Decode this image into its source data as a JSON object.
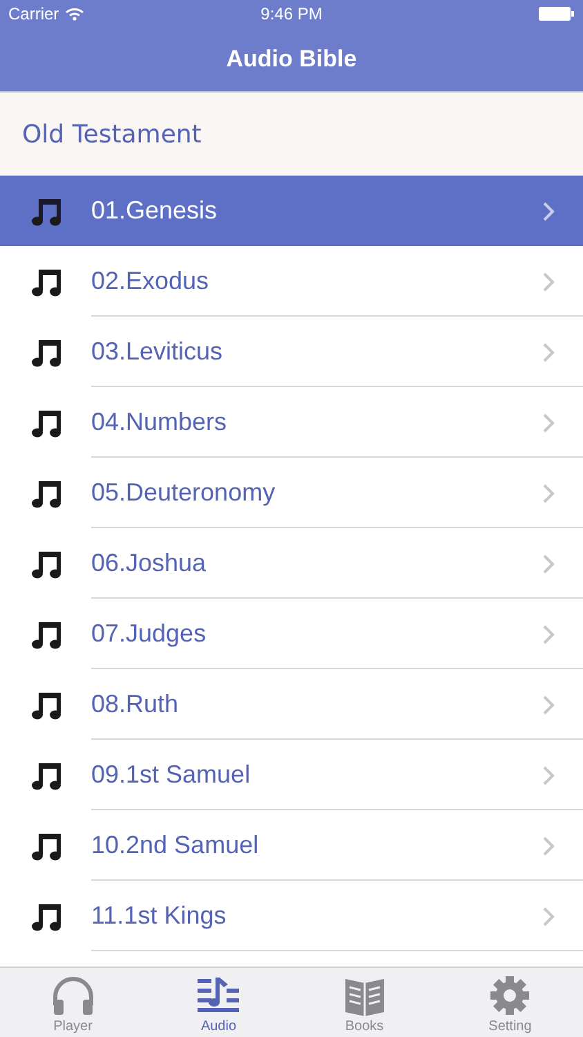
{
  "status_bar": {
    "carrier": "Carrier",
    "time": "9:46 PM"
  },
  "nav_bar": {
    "title": "Audio Bible"
  },
  "section": {
    "title": "Old Testament"
  },
  "rows": [
    {
      "label": "01.Genesis",
      "selected": true
    },
    {
      "label": "02.Exodus",
      "selected": false
    },
    {
      "label": "03.Leviticus",
      "selected": false
    },
    {
      "label": "04.Numbers",
      "selected": false
    },
    {
      "label": "05.Deuteronomy",
      "selected": false
    },
    {
      "label": "06.Joshua",
      "selected": false
    },
    {
      "label": "07.Judges",
      "selected": false
    },
    {
      "label": "08.Ruth",
      "selected": false
    },
    {
      "label": "09.1st Samuel",
      "selected": false
    },
    {
      "label": "10.2nd Samuel",
      "selected": false
    },
    {
      "label": "11.1st Kings",
      "selected": false
    }
  ],
  "tab_bar": [
    {
      "label": "Player",
      "kind": "headphones",
      "selected": false
    },
    {
      "label": "Audio",
      "kind": "notes",
      "selected": true
    },
    {
      "label": "Books",
      "kind": "book",
      "selected": false
    },
    {
      "label": "Setting",
      "kind": "gear",
      "selected": false
    }
  ]
}
